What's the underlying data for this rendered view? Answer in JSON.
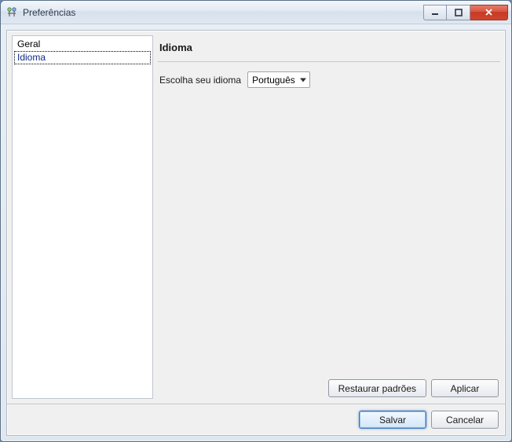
{
  "window": {
    "title": "Preferências"
  },
  "sidebar": {
    "items": [
      {
        "label": "Geral"
      },
      {
        "label": "Idioma"
      }
    ],
    "selectedIndex": 1
  },
  "page": {
    "title": "Idioma",
    "languageLabel": "Escolha seu idioma",
    "languageValue": "Português"
  },
  "buttons": {
    "restoreDefaults": "Restaurar padrões",
    "apply": "Aplicar",
    "save": "Salvar",
    "cancel": "Cancelar"
  }
}
